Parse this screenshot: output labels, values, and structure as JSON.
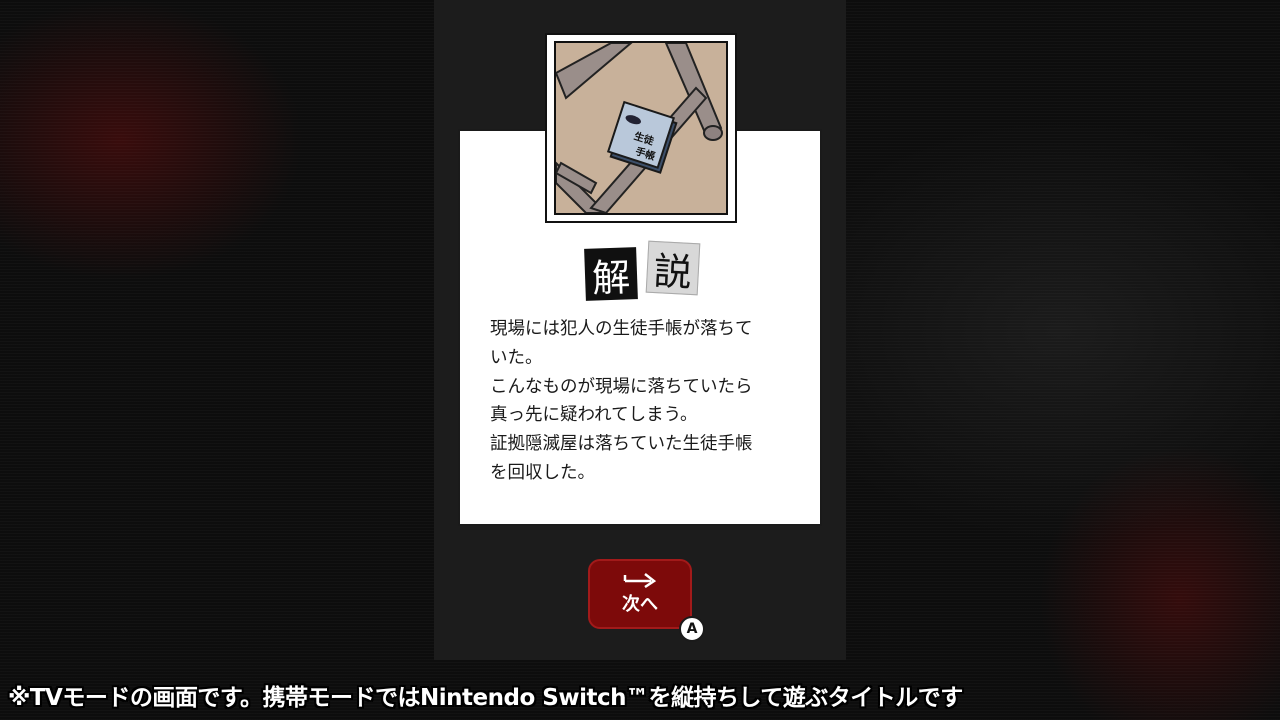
{
  "accent_color": "#7d0a0a",
  "card": {
    "image_name": "student-handbook-under-chair",
    "image_text": "生徒手帳",
    "heading_chars": [
      "解",
      "説"
    ],
    "body": "現場には犯人の生徒手帳が落ちて\nいた。\nこんなものが現場に落ちていたら\n真っ先に疑われてしまう。\n証拠隠滅屋は落ちていた生徒手帳\nを回収した。"
  },
  "next_button": {
    "icon": "arrow-right-icon",
    "label": "次へ",
    "key": "A"
  },
  "footer": {
    "note": "※TVモードの画面です。携帯モードではNintendo Switch™を縦持ちして遊ぶタイトルです"
  }
}
